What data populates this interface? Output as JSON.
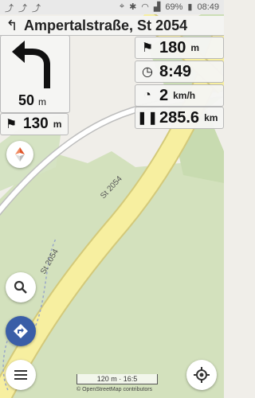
{
  "status_bar": {
    "left_icons": [
      "nav-icon",
      "nav-icon",
      "nav-icon"
    ],
    "battery": "69%",
    "time": "08:49"
  },
  "street": {
    "name": "Ampertalstraße, St 2054"
  },
  "turn": {
    "distance_value": "50",
    "distance_unit": "m"
  },
  "left_metric": {
    "value": "130",
    "unit": "m"
  },
  "metrics": [
    {
      "icon": "flag-icon",
      "value": "180",
      "unit": "m"
    },
    {
      "icon": "clock-icon",
      "value": "8:49",
      "unit": ""
    },
    {
      "icon": "speedometer-icon",
      "value": "2",
      "unit": "km/h"
    },
    {
      "icon": "pause-icon",
      "value": "285.6",
      "unit": "km"
    }
  ],
  "map": {
    "road_labels": [
      "St 2054",
      "St 2054"
    ],
    "scale_text": "120 m · 16:5",
    "attribution": "© OpenStreetMap contributors"
  },
  "colors": {
    "road": "#f7efa0",
    "road_edge": "#d3c97a",
    "forest": "#c9dcb4",
    "fab_blue": "#3a5ea7"
  }
}
